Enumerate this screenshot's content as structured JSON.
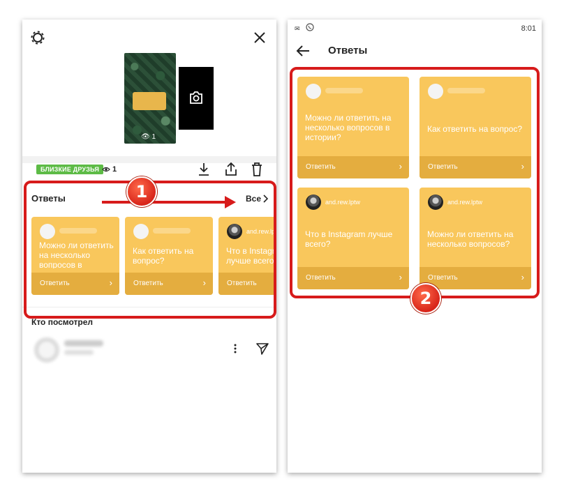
{
  "left": {
    "story_views": "👁 1",
    "badge": "БЛИЗКИЕ ДРУЗЬЯ",
    "view_count": "1",
    "answers_title": "Ответы",
    "see_all": "Все",
    "viewers_title": "Кто посмотрел",
    "cards": [
      {
        "question": "Можно ли ответить на несколько вопросов в истории?",
        "reply": "Ответить",
        "username": ""
      },
      {
        "question": "Как ответить на вопрос?",
        "reply": "Ответить",
        "username": ""
      },
      {
        "question": "Что в Instagram лучше всего?",
        "reply": "Ответить",
        "username": "and.rew.lptw"
      }
    ]
  },
  "right": {
    "status_time": "8:01",
    "title": "Ответы",
    "cards": [
      {
        "question": "Можно ли ответить на несколько вопросов в истории?",
        "reply": "Ответить",
        "username": ""
      },
      {
        "question": "Как ответить на вопрос?",
        "reply": "Ответить",
        "username": ""
      },
      {
        "question": "Что в Instagram лучше всего?",
        "reply": "Ответить",
        "username": "and.rew.lptw"
      },
      {
        "question": "Можно ли ответить на несколько вопросов?",
        "reply": "Ответить",
        "username": "and.rew.lptw"
      }
    ]
  },
  "annotations": {
    "step1": "1",
    "step2": "2"
  },
  "colors": {
    "card": "#f9c75c",
    "card_footer": "#e4ad3f",
    "badge": "#5dbb46",
    "highlight": "#d71b1b"
  },
  "icons": [
    "settings-icon",
    "close-icon",
    "camera-icon",
    "eye-icon",
    "download-icon",
    "share-icon",
    "delete-icon",
    "chevron-right-icon",
    "more-vertical-icon",
    "send-icon",
    "back-arrow-icon",
    "viber-icon",
    "notification-icon"
  ]
}
